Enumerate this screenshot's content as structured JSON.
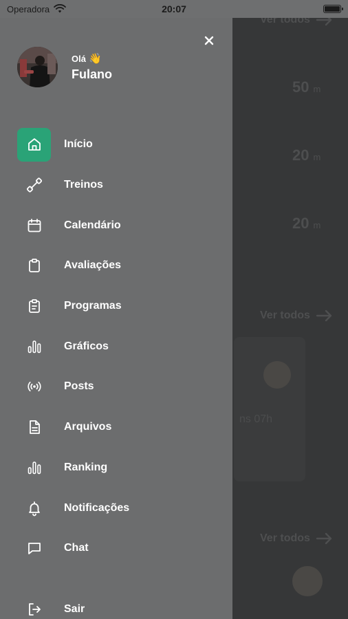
{
  "status_bar": {
    "carrier": "Operadora",
    "time": "20:07",
    "battery_level": 1.0
  },
  "background": {
    "link_top": "Ver todos",
    "stats": [
      {
        "value": "50",
        "unit": "m"
      },
      {
        "value": "20",
        "unit": "m"
      },
      {
        "value": "20",
        "unit": "m"
      }
    ],
    "link_mid": "Ver todos",
    "card_meta": "ns 07h",
    "link_bottom": "Ver todos"
  },
  "drawer": {
    "greeting": "Olá",
    "greeting_emoji": "👋",
    "user_name": "Fulano",
    "accent_color": "#2aa377",
    "menu": [
      {
        "label": "Início",
        "icon": "home-icon",
        "active": true
      },
      {
        "label": "Treinos",
        "icon": "dumbbell-icon",
        "active": false
      },
      {
        "label": "Calendário",
        "icon": "calendar-icon",
        "active": false
      },
      {
        "label": "Avaliações",
        "icon": "clipboard-icon",
        "active": false
      },
      {
        "label": "Programas",
        "icon": "clipboard-list-icon",
        "active": false
      },
      {
        "label": "Gráficos",
        "icon": "bar-chart-icon",
        "active": false
      },
      {
        "label": "Posts",
        "icon": "broadcast-icon",
        "active": false
      },
      {
        "label": "Arquivos",
        "icon": "file-icon",
        "active": false
      },
      {
        "label": "Ranking",
        "icon": "ranking-icon",
        "active": false
      },
      {
        "label": "Notificações",
        "icon": "bell-icon",
        "active": false
      },
      {
        "label": "Chat",
        "icon": "chat-icon",
        "active": false
      }
    ],
    "logout_label": "Sair"
  }
}
